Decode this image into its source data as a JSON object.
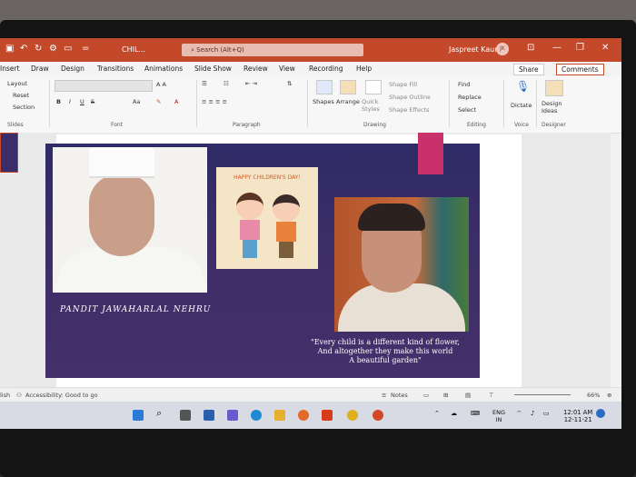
{
  "titlebar": {
    "filename": "CHIL...",
    "search_placeholder": "Search (Alt+Q)",
    "user_name": "Jaspreet Kaur",
    "user_initials": "JK"
  },
  "menu": {
    "tabs": [
      "Insert",
      "Draw",
      "Design",
      "Transitions",
      "Animations",
      "Slide Show",
      "Review",
      "View",
      "Recording",
      "Help"
    ],
    "share": "Share",
    "comments": "Comments"
  },
  "ribbon": {
    "slides": {
      "layout": "Layout",
      "reset": "Reset",
      "section": "Section",
      "label": "Slides"
    },
    "font": {
      "label": "Font",
      "size_btn": "A A",
      "bold": "B",
      "italic": "I",
      "underline": "U",
      "strike": "S",
      "case": "Aa"
    },
    "paragraph": {
      "label": "Paragraph"
    },
    "drawing": {
      "shapes": "Shapes",
      "arrange": "Arrange",
      "quick_styles": "Quick Styles",
      "shape_fill": "Shape Fill",
      "shape_outline": "Shape Outline",
      "shape_effects": "Shape Effects",
      "label": "Drawing"
    },
    "editing": {
      "find": "Find",
      "replace": "Replace",
      "select": "Select",
      "label": "Editing"
    },
    "voice": {
      "dictate": "Dictate",
      "label": "Voice"
    },
    "designer": {
      "ideas": "Design Ideas",
      "label": "Designer"
    }
  },
  "slide": {
    "card_title": "HAPPY CHILDREN'S DAY!",
    "name_label": "PANDIT JAWAHARLAL NEHRU",
    "quote_lines": [
      "\"Every child is a different kind of flower,",
      "And altogether they make this world",
      "A beautiful garden\""
    ]
  },
  "statusbar": {
    "left": "lish",
    "accessibility": "Accessibility: Good to go",
    "notes": "Notes",
    "zoom": "66%"
  },
  "taskbar": {
    "lang1": "ENG",
    "lang2": "IN",
    "time": "12:01 AM",
    "date": "12-11-21"
  },
  "colors": {
    "accent": "#c4482a",
    "slide_bg": "#3d2f69",
    "sticky": "#c9316a"
  }
}
